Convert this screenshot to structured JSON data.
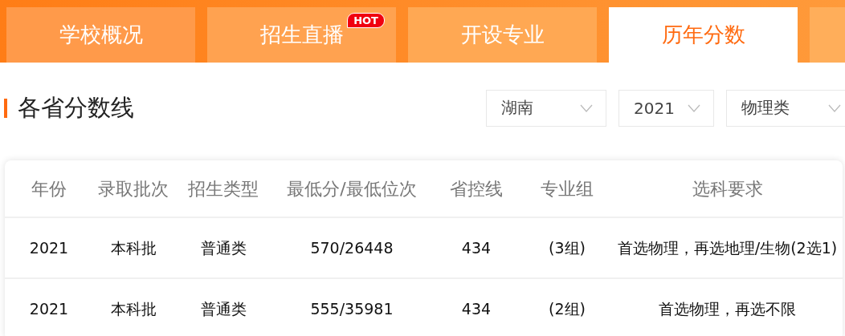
{
  "tabs": [
    {
      "label": "学校概况",
      "selected": false
    },
    {
      "label": "招生直播",
      "selected": false,
      "badge": "HOT"
    },
    {
      "label": "开设专业",
      "selected": false
    },
    {
      "label": "历年分数",
      "selected": true
    }
  ],
  "section": {
    "title": "各省分数线",
    "filters": [
      {
        "value": "湖南"
      },
      {
        "value": "2021"
      },
      {
        "value": "物理类"
      }
    ]
  },
  "table": {
    "columns": [
      "年份",
      "录取批次",
      "招生类型",
      "最低分/最低位次",
      "省控线",
      "专业组",
      "选科要求"
    ],
    "rows": [
      [
        "2021",
        "本科批",
        "普通类",
        "570/26448",
        "434",
        "(3组)",
        "首选物理，再选地理/生物(2选1)"
      ],
      [
        "2021",
        "本科批",
        "普通类",
        "555/35981",
        "434",
        "(2组)",
        "首选物理，再选不限"
      ]
    ]
  }
}
